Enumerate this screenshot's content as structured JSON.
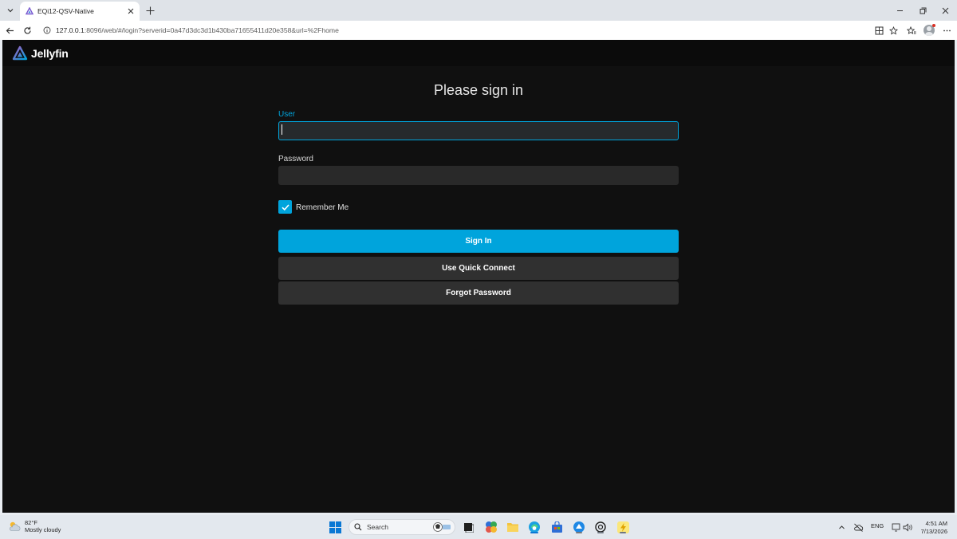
{
  "browser": {
    "tab_title": "EQi12-QSV-Native",
    "url_host": "127.0.0.1",
    "url_rest": ":8096/web/#/login?serverid=0a47d3dc3d1b430ba71655411d20e358&url=%2Fhome"
  },
  "app": {
    "logo_text": "Jellyfin",
    "accent_color": "#00a4dc"
  },
  "login": {
    "title": "Please sign in",
    "user_label": "User",
    "user_value": "",
    "password_label": "Password",
    "password_value": "",
    "remember_label": "Remember Me",
    "remember_checked": true,
    "sign_in_label": "Sign In",
    "quick_connect_label": "Use Quick Connect",
    "forgot_label": "Forgot Password"
  },
  "taskbar": {
    "weather_temp": "82°F",
    "weather_desc": "Mostly cloudy",
    "search_placeholder": "Search",
    "language": "ENG",
    "time": "4:51 AM",
    "date": "7/13/2026"
  }
}
